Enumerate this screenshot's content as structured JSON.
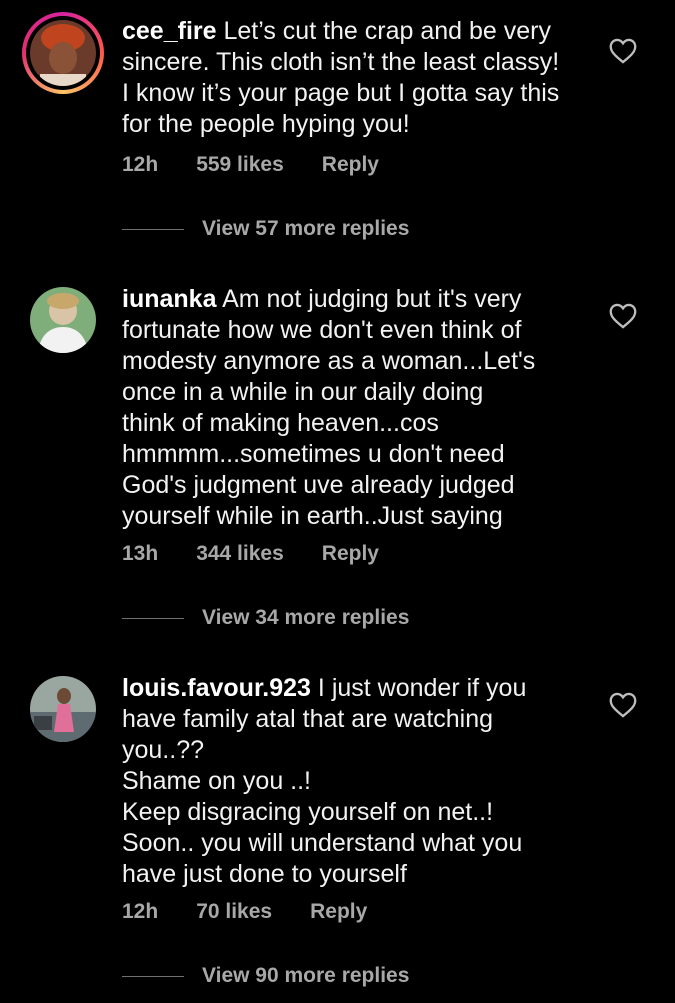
{
  "comments": [
    {
      "username": "cee_fire",
      "text": "Let’s cut the crap and be very\nsincere. This cloth isn’t the least classy!\nI know it’s your page but I gotta say this\nfor the people hyping you!",
      "time": "12h",
      "likes": "559 likes",
      "reply_label": "Reply",
      "view_replies": "View 57 more replies"
    },
    {
      "username": "iunanka",
      "text": "Am not judging but it's very\nfortunate how we don't even think of\nmodesty anymore as a woman...Let's\nonce in a while in our daily doing\nthink of making heaven...cos\nhmmmm...sometimes u don't need\nGod's judgment uve already judged\nyourself while in earth..Just saying",
      "time": "13h",
      "likes": "344 likes",
      "reply_label": "Reply",
      "view_replies": "View 34 more replies"
    },
    {
      "username": "louis.favour.923",
      "text": "I just wonder if you\nhave family atal that are watching\nyou..??\nShame on you ..!\nKeep disgracing yourself on net..!\nSoon.. you will understand what you\nhave just done to yourself",
      "time": "12h",
      "likes": "70 likes",
      "reply_label": "Reply",
      "view_replies": "View 90 more replies"
    }
  ],
  "icons": {
    "like": "heart-outline-icon",
    "story_ring_colors": [
      "#d6249f",
      "#fd5949",
      "#fdc468"
    ]
  }
}
